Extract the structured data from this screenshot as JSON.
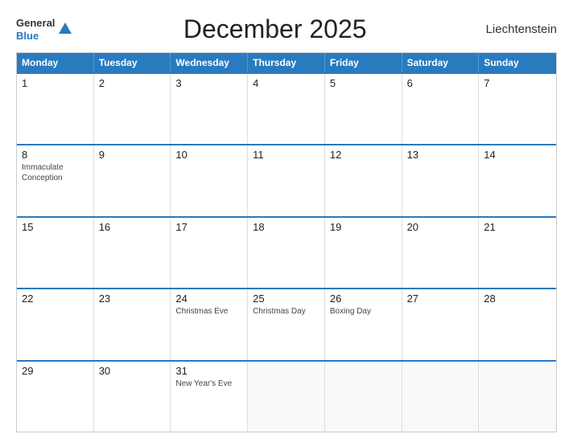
{
  "header": {
    "logo_line1": "General",
    "logo_line2": "Blue",
    "title": "December 2025",
    "country": "Liechtenstein"
  },
  "calendar": {
    "days_of_week": [
      "Monday",
      "Tuesday",
      "Wednesday",
      "Thursday",
      "Friday",
      "Saturday",
      "Sunday"
    ],
    "weeks": [
      [
        {
          "day": "1",
          "holiday": ""
        },
        {
          "day": "2",
          "holiday": ""
        },
        {
          "day": "3",
          "holiday": ""
        },
        {
          "day": "4",
          "holiday": ""
        },
        {
          "day": "5",
          "holiday": ""
        },
        {
          "day": "6",
          "holiday": ""
        },
        {
          "day": "7",
          "holiday": ""
        }
      ],
      [
        {
          "day": "8",
          "holiday": "Immaculate\nConception"
        },
        {
          "day": "9",
          "holiday": ""
        },
        {
          "day": "10",
          "holiday": ""
        },
        {
          "day": "11",
          "holiday": ""
        },
        {
          "day": "12",
          "holiday": ""
        },
        {
          "day": "13",
          "holiday": ""
        },
        {
          "day": "14",
          "holiday": ""
        }
      ],
      [
        {
          "day": "15",
          "holiday": ""
        },
        {
          "day": "16",
          "holiday": ""
        },
        {
          "day": "17",
          "holiday": ""
        },
        {
          "day": "18",
          "holiday": ""
        },
        {
          "day": "19",
          "holiday": ""
        },
        {
          "day": "20",
          "holiday": ""
        },
        {
          "day": "21",
          "holiday": ""
        }
      ],
      [
        {
          "day": "22",
          "holiday": ""
        },
        {
          "day": "23",
          "holiday": ""
        },
        {
          "day": "24",
          "holiday": "Christmas Eve"
        },
        {
          "day": "25",
          "holiday": "Christmas Day"
        },
        {
          "day": "26",
          "holiday": "Boxing Day"
        },
        {
          "day": "27",
          "holiday": ""
        },
        {
          "day": "28",
          "holiday": ""
        }
      ],
      [
        {
          "day": "29",
          "holiday": ""
        },
        {
          "day": "30",
          "holiday": ""
        },
        {
          "day": "31",
          "holiday": "New Year's Eve"
        },
        {
          "day": "",
          "holiday": ""
        },
        {
          "day": "",
          "holiday": ""
        },
        {
          "day": "",
          "holiday": ""
        },
        {
          "day": "",
          "holiday": ""
        }
      ]
    ]
  }
}
